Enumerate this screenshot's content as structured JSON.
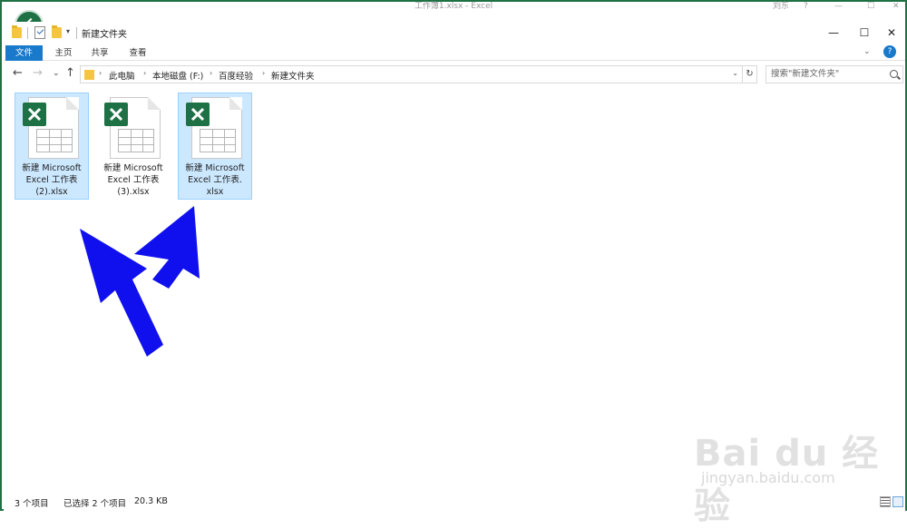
{
  "excel": {
    "title": "工作簿1.xlsx  -  Excel",
    "user": "刘东",
    "help": "?",
    "min": "—",
    "max": "☐",
    "close": "✕"
  },
  "window": {
    "title": "新建文件夹",
    "min": "—",
    "max": "☐",
    "close": "✕",
    "qa_drop": "▾"
  },
  "ribbon": {
    "tabs": [
      "文件",
      "主页",
      "共享",
      "查看"
    ],
    "chevron": "⌄",
    "help": "?"
  },
  "nav": {
    "back": "←",
    "forward": "→",
    "recent": "⌄",
    "up": "↑",
    "breadcrumb": [
      "此电脑",
      "本地磁盘 (F:)",
      "百度经验",
      "新建文件夹"
    ],
    "sep": "›",
    "addr_drop": "⌄",
    "refresh": "↻",
    "search_placeholder": "搜索\"新建文件夹\""
  },
  "files": [
    {
      "line1": "新建 Microsoft",
      "line2": "Excel 工作表",
      "line3": "(2).xlsx",
      "selected": true
    },
    {
      "line1": "新建 Microsoft",
      "line2": "Excel 工作表",
      "line3": "(3).xlsx",
      "selected": false
    },
    {
      "line1": "新建 Microsoft",
      "line2": "Excel 工作表.",
      "line3": "xlsx",
      "selected": true
    }
  ],
  "status": {
    "count": "3 个项目",
    "selection": "已选择 2 个项目",
    "size": "20.3 KB"
  },
  "watermark": {
    "logo": "Bai du 经验",
    "url": "jingyan.baidu.com"
  },
  "colors": {
    "excel_green": "#1e7145",
    "selection": "#cce8ff",
    "file_tab": "#1979ca",
    "arrow": "#1010ee"
  }
}
